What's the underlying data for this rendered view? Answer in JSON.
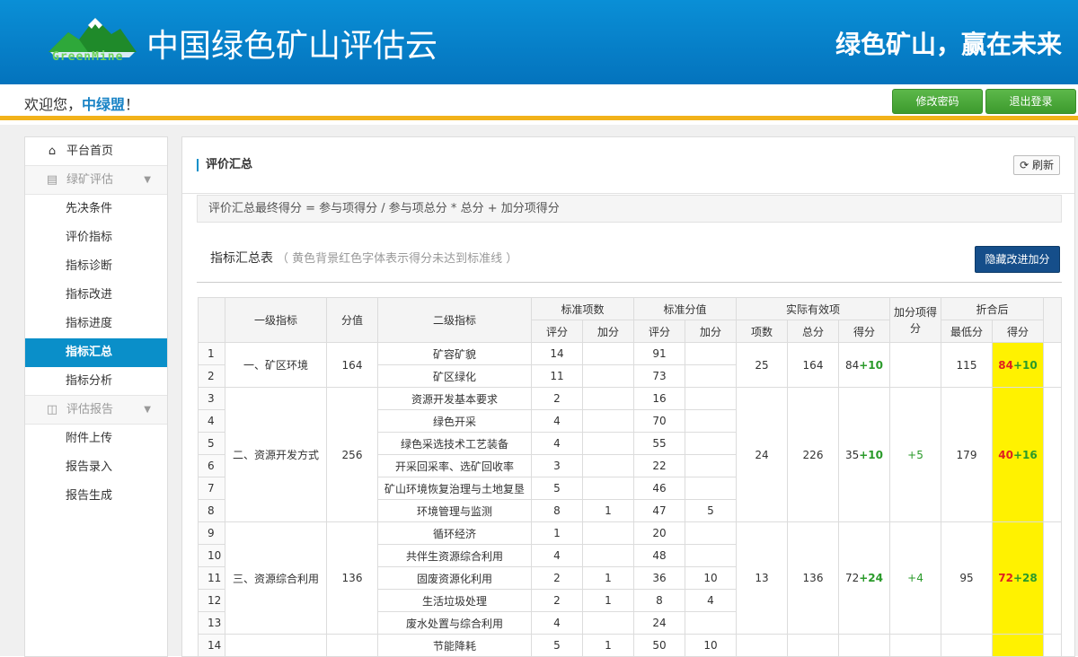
{
  "header": {
    "logo_text": "GreenMine",
    "app_title": "中国绿色矿山评估云",
    "slogan": "绿色矿山，赢在未来"
  },
  "userbar": {
    "welcome_prefix": "欢迎您，",
    "username": "中绿盟",
    "welcome_suffix": "！",
    "change_password": "修改密码",
    "logout": "退出登录"
  },
  "sidebar": {
    "home": "平台首页",
    "group1": "绿矿评估",
    "group1_items": [
      "先决条件",
      "评价指标",
      "指标诊断",
      "指标改进",
      "指标进度",
      "指标汇总",
      "指标分析"
    ],
    "active_item": "指标汇总",
    "group2": "评估报告",
    "group2_items": [
      "附件上传",
      "报告录入",
      "报告生成"
    ]
  },
  "panel": {
    "title": "评价汇总",
    "refresh": "刷新",
    "formula": "评价汇总最终得分 = 参与项得分 / 参与项总分 * 总分 + 加分项得分",
    "table_title": "指标汇总表",
    "table_note": "（ 黄色背景红色字体表示得分未达到标准线 ）",
    "hide_button": "隐藏改进加分"
  },
  "table": {
    "headers": {
      "level1": "一级指标",
      "score": "分值",
      "level2": "二级指标",
      "std_count": "标准项数",
      "std_value": "标准分值",
      "actual": "实际有效项",
      "bonus": "加分项得分",
      "converted": "折合后",
      "eval": "评分",
      "add": "加分",
      "items": "项数",
      "total": "总分",
      "got": "得分",
      "min": "最低分",
      "final": "得分"
    },
    "groups": [
      {
        "name": "一、矿区环境",
        "score": "164",
        "actual_items": "25",
        "actual_total": "164",
        "actual_got": "84",
        "actual_got_plus": "+10",
        "bonus": "",
        "min": "115",
        "final": "84",
        "final_plus": "+10",
        "rows": [
          {
            "idx": "1",
            "name": "矿容矿貌",
            "sc_eval": "14",
            "sc_add": "",
            "sv_eval": "91",
            "sv_add": ""
          },
          {
            "idx": "2",
            "name": "矿区绿化",
            "sc_eval": "11",
            "sc_add": "",
            "sv_eval": "73",
            "sv_add": ""
          }
        ]
      },
      {
        "name": "二、资源开发方式",
        "score": "256",
        "actual_items": "24",
        "actual_total": "226",
        "actual_got": "35",
        "actual_got_plus": "+10",
        "bonus": "+5",
        "min": "179",
        "final": "40",
        "final_plus": "+16",
        "rows": [
          {
            "idx": "3",
            "name": "资源开发基本要求",
            "sc_eval": "2",
            "sc_add": "",
            "sv_eval": "16",
            "sv_add": ""
          },
          {
            "idx": "4",
            "name": "绿色开采",
            "sc_eval": "4",
            "sc_add": "",
            "sv_eval": "70",
            "sv_add": ""
          },
          {
            "idx": "5",
            "name": "绿色采选技术工艺装备",
            "sc_eval": "4",
            "sc_add": "",
            "sv_eval": "55",
            "sv_add": ""
          },
          {
            "idx": "6",
            "name": "开采回采率、选矿回收率",
            "sc_eval": "3",
            "sc_add": "",
            "sv_eval": "22",
            "sv_add": ""
          },
          {
            "idx": "7",
            "name": "矿山环境恢复治理与土地复垦",
            "sc_eval": "5",
            "sc_add": "",
            "sv_eval": "46",
            "sv_add": ""
          },
          {
            "idx": "8",
            "name": "环境管理与监测",
            "sc_eval": "8",
            "sc_add": "1",
            "sv_eval": "47",
            "sv_add": "5"
          }
        ]
      },
      {
        "name": "三、资源综合利用",
        "score": "136",
        "actual_items": "13",
        "actual_total": "136",
        "actual_got": "72",
        "actual_got_plus": "+24",
        "bonus": "+4",
        "min": "95",
        "final": "72",
        "final_plus": "+28",
        "rows": [
          {
            "idx": "9",
            "name": "循环经济",
            "sc_eval": "1",
            "sc_add": "",
            "sv_eval": "20",
            "sv_add": ""
          },
          {
            "idx": "10",
            "name": "共伴生资源综合利用",
            "sc_eval": "4",
            "sc_add": "",
            "sv_eval": "48",
            "sv_add": ""
          },
          {
            "idx": "11",
            "name": "固废资源化利用",
            "sc_eval": "2",
            "sc_add": "1",
            "sv_eval": "36",
            "sv_add": "10"
          },
          {
            "idx": "12",
            "name": "生活垃圾处理",
            "sc_eval": "2",
            "sc_add": "1",
            "sv_eval": "8",
            "sv_add": "4"
          },
          {
            "idx": "13",
            "name": "废水处置与综合利用",
            "sc_eval": "4",
            "sc_add": "",
            "sv_eval": "24",
            "sv_add": ""
          }
        ]
      },
      {
        "name": "",
        "score": "",
        "actual_items": "",
        "actual_total": "",
        "actual_got": "",
        "actual_got_plus": "",
        "bonus": "",
        "min": "",
        "final": "",
        "final_plus": "",
        "rows": [
          {
            "idx": "14",
            "name": "节能降耗",
            "sc_eval": "5",
            "sc_add": "1",
            "sv_eval": "50",
            "sv_add": "10"
          }
        ]
      }
    ]
  }
}
